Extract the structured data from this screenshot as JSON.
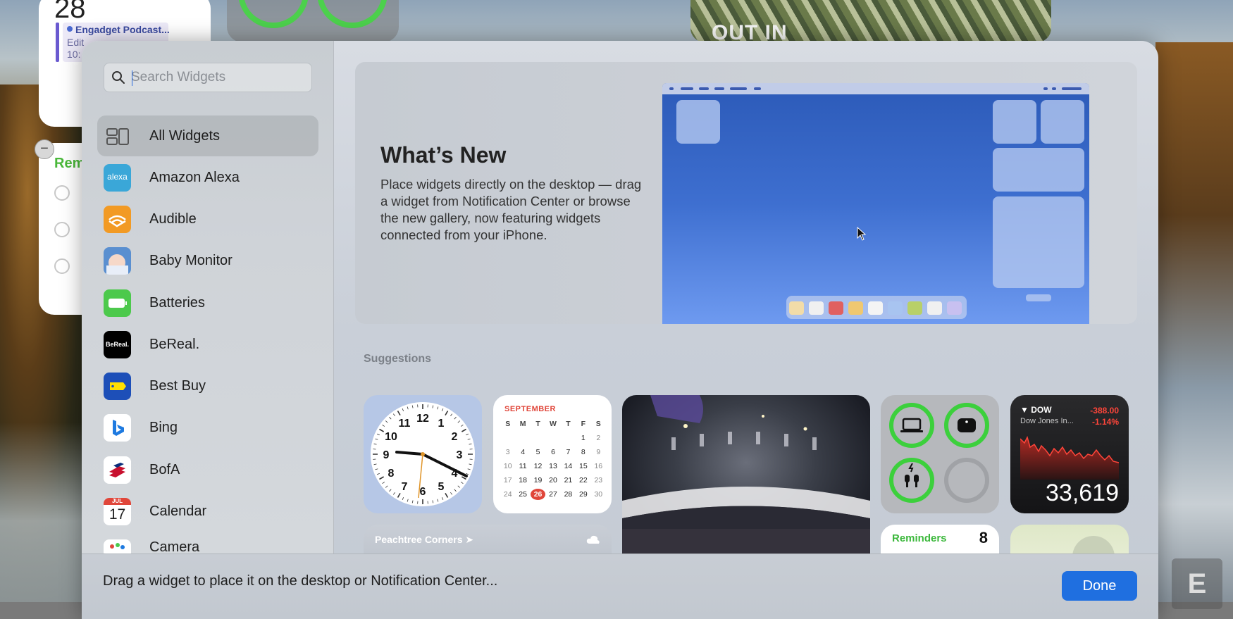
{
  "desktop": {
    "calendar_widget": {
      "day": "28",
      "event_title": "Engadget Podcast...",
      "event_line1": "Edit",
      "event_line2": "10:"
    },
    "reminders_widget": {
      "title": "Rem"
    },
    "photo_widget": {
      "text": "OUT IN"
    }
  },
  "gallery": {
    "search": {
      "placeholder": "Search Widgets",
      "value": ""
    },
    "sidebar": {
      "items": [
        {
          "label": "All Widgets",
          "icon": "all-widgets-icon",
          "active": true
        },
        {
          "label": "Amazon Alexa",
          "icon": "amazon-alexa-icon",
          "icon_text": "alexa",
          "color": "#3aa7d8"
        },
        {
          "label": "Audible",
          "icon": "audible-icon",
          "color": "#f29a24"
        },
        {
          "label": "Baby Monitor",
          "icon": "baby-monitor-icon",
          "color": "#5a8fd0"
        },
        {
          "label": "Batteries",
          "icon": "batteries-icon",
          "color": "#4cc94c"
        },
        {
          "label": "BeReal.",
          "icon": "bereal-icon",
          "icon_text": "BeReal.",
          "color": "#000000"
        },
        {
          "label": "Best Buy",
          "icon": "best-buy-icon",
          "color": "#1d4fb8"
        },
        {
          "label": "Bing",
          "icon": "bing-icon",
          "color": "#ffffff"
        },
        {
          "label": "BofA",
          "icon": "bofa-icon",
          "color": "#ffffff"
        },
        {
          "label": "Calendar",
          "icon": "calendar-icon",
          "icon_month": "JUL",
          "icon_day": "17"
        },
        {
          "label": "Camera",
          "icon": "camera-icon"
        }
      ]
    },
    "hero": {
      "title": "What’s New",
      "body": "Place widgets directly on the desktop — drag a widget from Notification Center or browse the new gallery, now featuring widgets connected from your iPhone."
    },
    "suggestions": {
      "title": "Suggestions",
      "calendar": {
        "month": "SEPTEMBER",
        "weekdays": [
          "S",
          "M",
          "T",
          "W",
          "T",
          "F",
          "S"
        ],
        "weeks": [
          [
            "",
            "",
            "",
            "",
            "",
            "1",
            "2"
          ],
          [
            "3",
            "4",
            "5",
            "6",
            "7",
            "8",
            "9"
          ],
          [
            "10",
            "11",
            "12",
            "13",
            "14",
            "15",
            "16"
          ],
          [
            "17",
            "18",
            "19",
            "20",
            "21",
            "22",
            "23"
          ],
          [
            "24",
            "25",
            "26",
            "27",
            "28",
            "29",
            "30"
          ]
        ],
        "today": "26"
      },
      "clock": {
        "numbers": [
          "12",
          "1",
          "2",
          "3",
          "4",
          "5",
          "6",
          "7",
          "8",
          "9",
          "10",
          "11"
        ]
      },
      "stocks": {
        "symbol": "DOW",
        "change": "-388.00",
        "percent": "-1.14%",
        "name": "Dow Jones In...",
        "value": "33,619"
      },
      "weather": {
        "city": "Peachtree Corners"
      },
      "reminders": {
        "title": "Reminders",
        "count": "8"
      }
    },
    "footer": {
      "message": "Drag a widget to place it on the desktop or Notification Center...",
      "done_label": "Done"
    }
  },
  "colors": {
    "accent": "#1f6fe0",
    "battery_ring": "#3cd03c",
    "stock_down": "#ff453a",
    "calendar_today": "#e0463a",
    "reminders_green": "#3cb83c"
  }
}
